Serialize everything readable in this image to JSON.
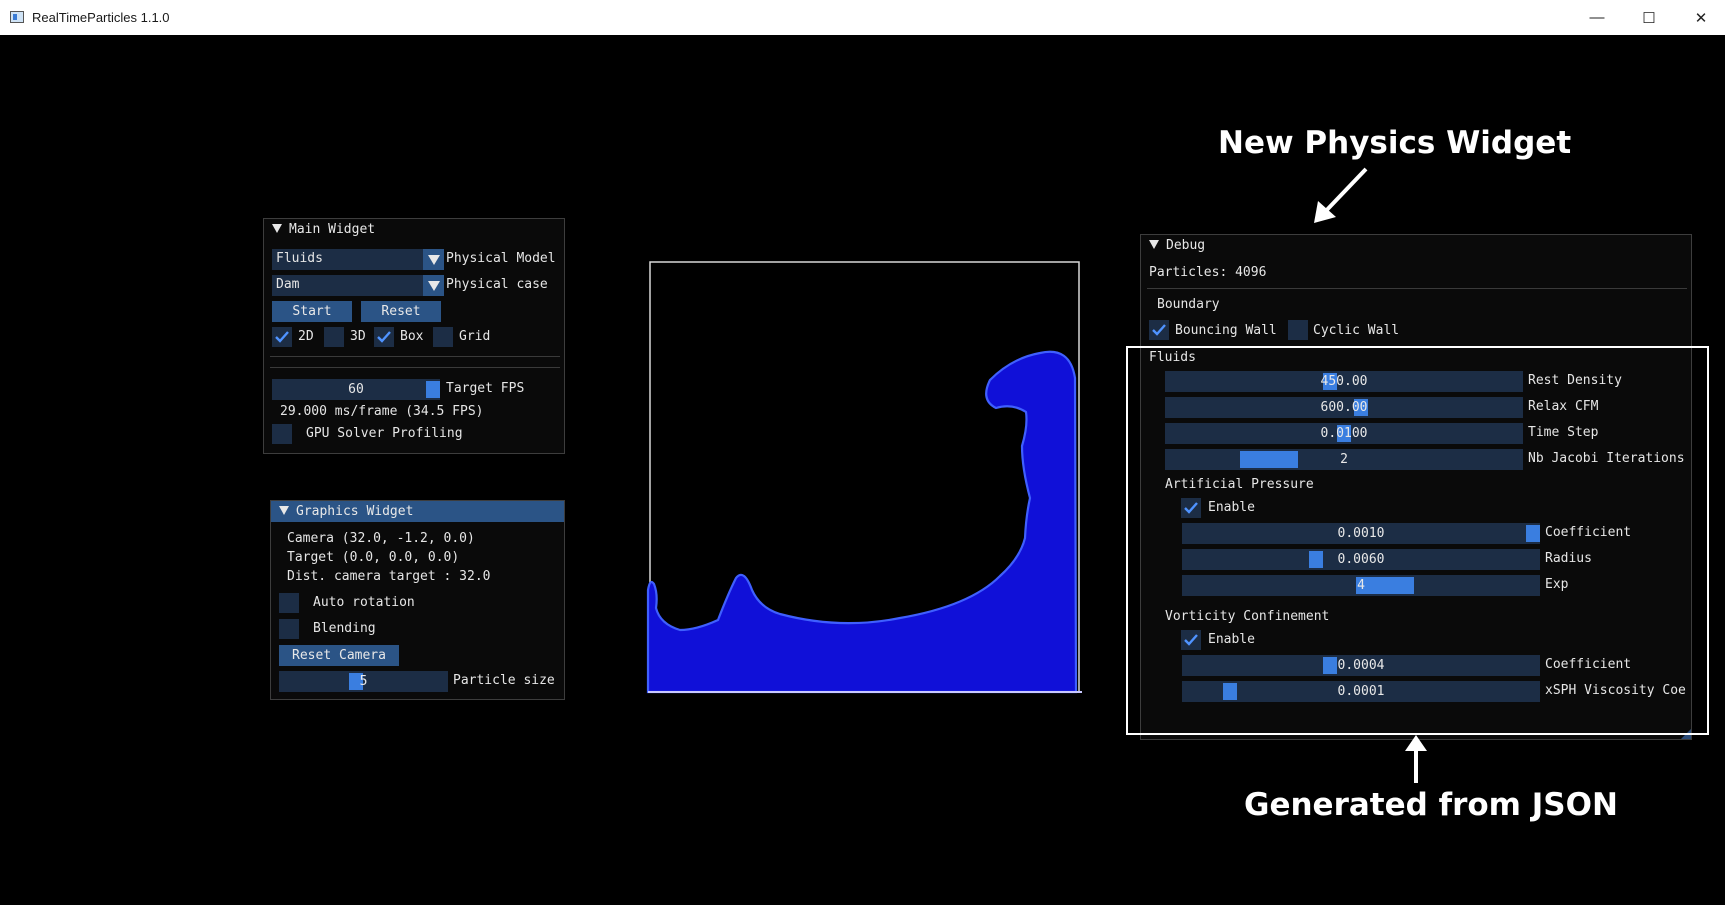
{
  "window": {
    "title": "RealTimeParticles 1.1.0",
    "minimize_glyph": "—",
    "maximize_glyph": "☐",
    "close_glyph": "✕"
  },
  "main_widget": {
    "title": "Main Widget",
    "model_value": "Fluids",
    "model_label": "Physical Model",
    "case_value": "Dam",
    "case_label": "Physical case",
    "start_label": "Start",
    "reset_label": "Reset",
    "check_2d": "2D",
    "check_3d": "3D",
    "check_box": "Box",
    "check_grid": "Grid",
    "fps_value": "60",
    "fps_label": "Target FPS",
    "fps_fraction": 1.0,
    "frame_stats": "29.000 ms/frame (34.5 FPS)",
    "profiling_label": "GPU Solver Profiling"
  },
  "graphics_widget": {
    "title": "Graphics Widget",
    "camera": "Camera (32.0, -1.2, 0.0)",
    "target": "Target (0.0, 0.0, 0.0)",
    "dist": "Dist. camera target : 32.0",
    "auto_rotation": "Auto rotation",
    "blending": "Blending",
    "reset_camera": "Reset Camera",
    "particle_size_value": "5",
    "particle_size_label": "Particle size",
    "particle_size_fraction": 0.45
  },
  "debug_widget": {
    "title": "Debug",
    "particles": "Particles: 4096",
    "boundary": "Boundary",
    "bouncing_wall": "Bouncing Wall",
    "cyclic_wall": "Cyclic Wall",
    "fluids": "Fluids",
    "rest_density": {
      "value": "450.00",
      "label": "Rest Density",
      "fraction": 0.46
    },
    "relax_cfm": {
      "value": "600.00",
      "label": "Relax CFM",
      "fraction": 0.55
    },
    "time_step": {
      "value": "0.0100",
      "label": "Time Step",
      "fraction": 0.5
    },
    "jacobi": {
      "value": "2",
      "label": "Nb Jacobi Iterations",
      "fraction": 0.25
    },
    "artificial_pressure": "Artificial Pressure",
    "ap_enable": "Enable",
    "ap_coefficient": {
      "value": "0.0010",
      "label": "Coefficient",
      "fraction": 1.0
    },
    "ap_radius": {
      "value": "0.0060",
      "label": "Radius",
      "fraction": 0.37
    },
    "ap_exp": {
      "value": "4",
      "label": "Exp",
      "fraction": 0.58
    },
    "vorticity_confinement": "Vorticity Confinement",
    "vc_enable": "Enable",
    "vc_coefficient": {
      "value": "0.0004",
      "label": "Coefficient",
      "fraction": 0.41
    },
    "xsph": {
      "value": "0.0001",
      "label": "xSPH Viscosity Coe",
      "fraction": 0.12
    }
  },
  "annotations": {
    "new_widget": "New Physics Widget",
    "generated": "Generated from JSON"
  },
  "colors": {
    "fluid": "#1010d8",
    "accent": "#3a7ee0",
    "frame_bg": "#1c2d45",
    "button": "#2b5486"
  }
}
